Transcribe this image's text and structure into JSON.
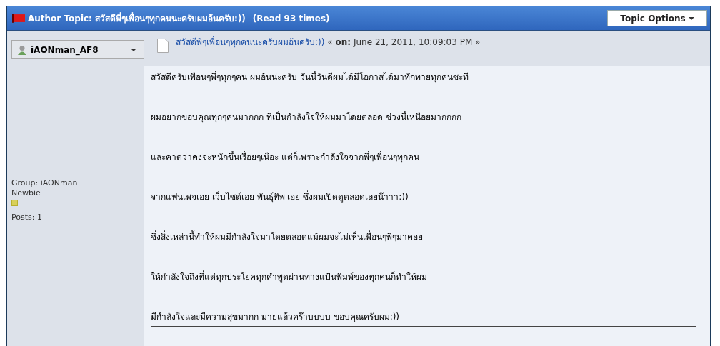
{
  "header": {
    "title": "Author Topic: สวัสดีพี่ๆเพื่อนๆทุกคนนะครับผมอ้นครับ:))",
    "read_count": "(Read 93 times)",
    "options_button": "Topic Options"
  },
  "post": {
    "author": "iAONman_AF8",
    "subject": "สวัสดีพี่ๆเพื่อนๆทุกคนนะครับผมอ้นครับ:))",
    "date_line": "« **on:** June 21, 2011, 10:09:03 PM »",
    "author_info": {
      "group": "Group: iAONman",
      "rank": "Newbie",
      "posts": "Posts: 1"
    },
    "body": [
      "สวัสดีครับเพื่อนๆพี่ๆทุกๆคน ผมอ้นน่ะครับ วันนี้วันดีผมได้มีโอกาสได้มาทักทายทุกคนซะที",
      "ผมอยากขอบคุณทุกๆคนมากกก ที่เป็นกำลังใจให้ผมมาโดยตลอด ช่วงนี้เหนื่อยมากกกก",
      "และคาดว่าคงจะหนักขึ้นเรื่อยๆเน๊อะ แต่ก็เพราะกำลังใจจากพี่ๆเพื่อนๆทุกคน",
      "จากแฟนเพจเอย เว็บไซต์เอย พันธุ์ทิพ เอย ซึ่งผมเปิดดูตลอดเลยน๊าาา:))",
      "ซึ่งสิ่งเหล่านี้ทำให้ผมมีกำลังใจมาโดยตลอดแม้ผมจะไม่เห็นเพื่อนๆพี่ๆมาคอย",
      "ให้กำลังใจถึงที่แต่ทุกประโยคทุกคำพูดผ่านทางแป้นพิมพ์ของทุกคนก็ทำให้ผม",
      "มีกำลังใจและมีความสุขมากก มายแล้วคร๊าบบบบ ขอบคุณครับผม:))"
    ]
  }
}
